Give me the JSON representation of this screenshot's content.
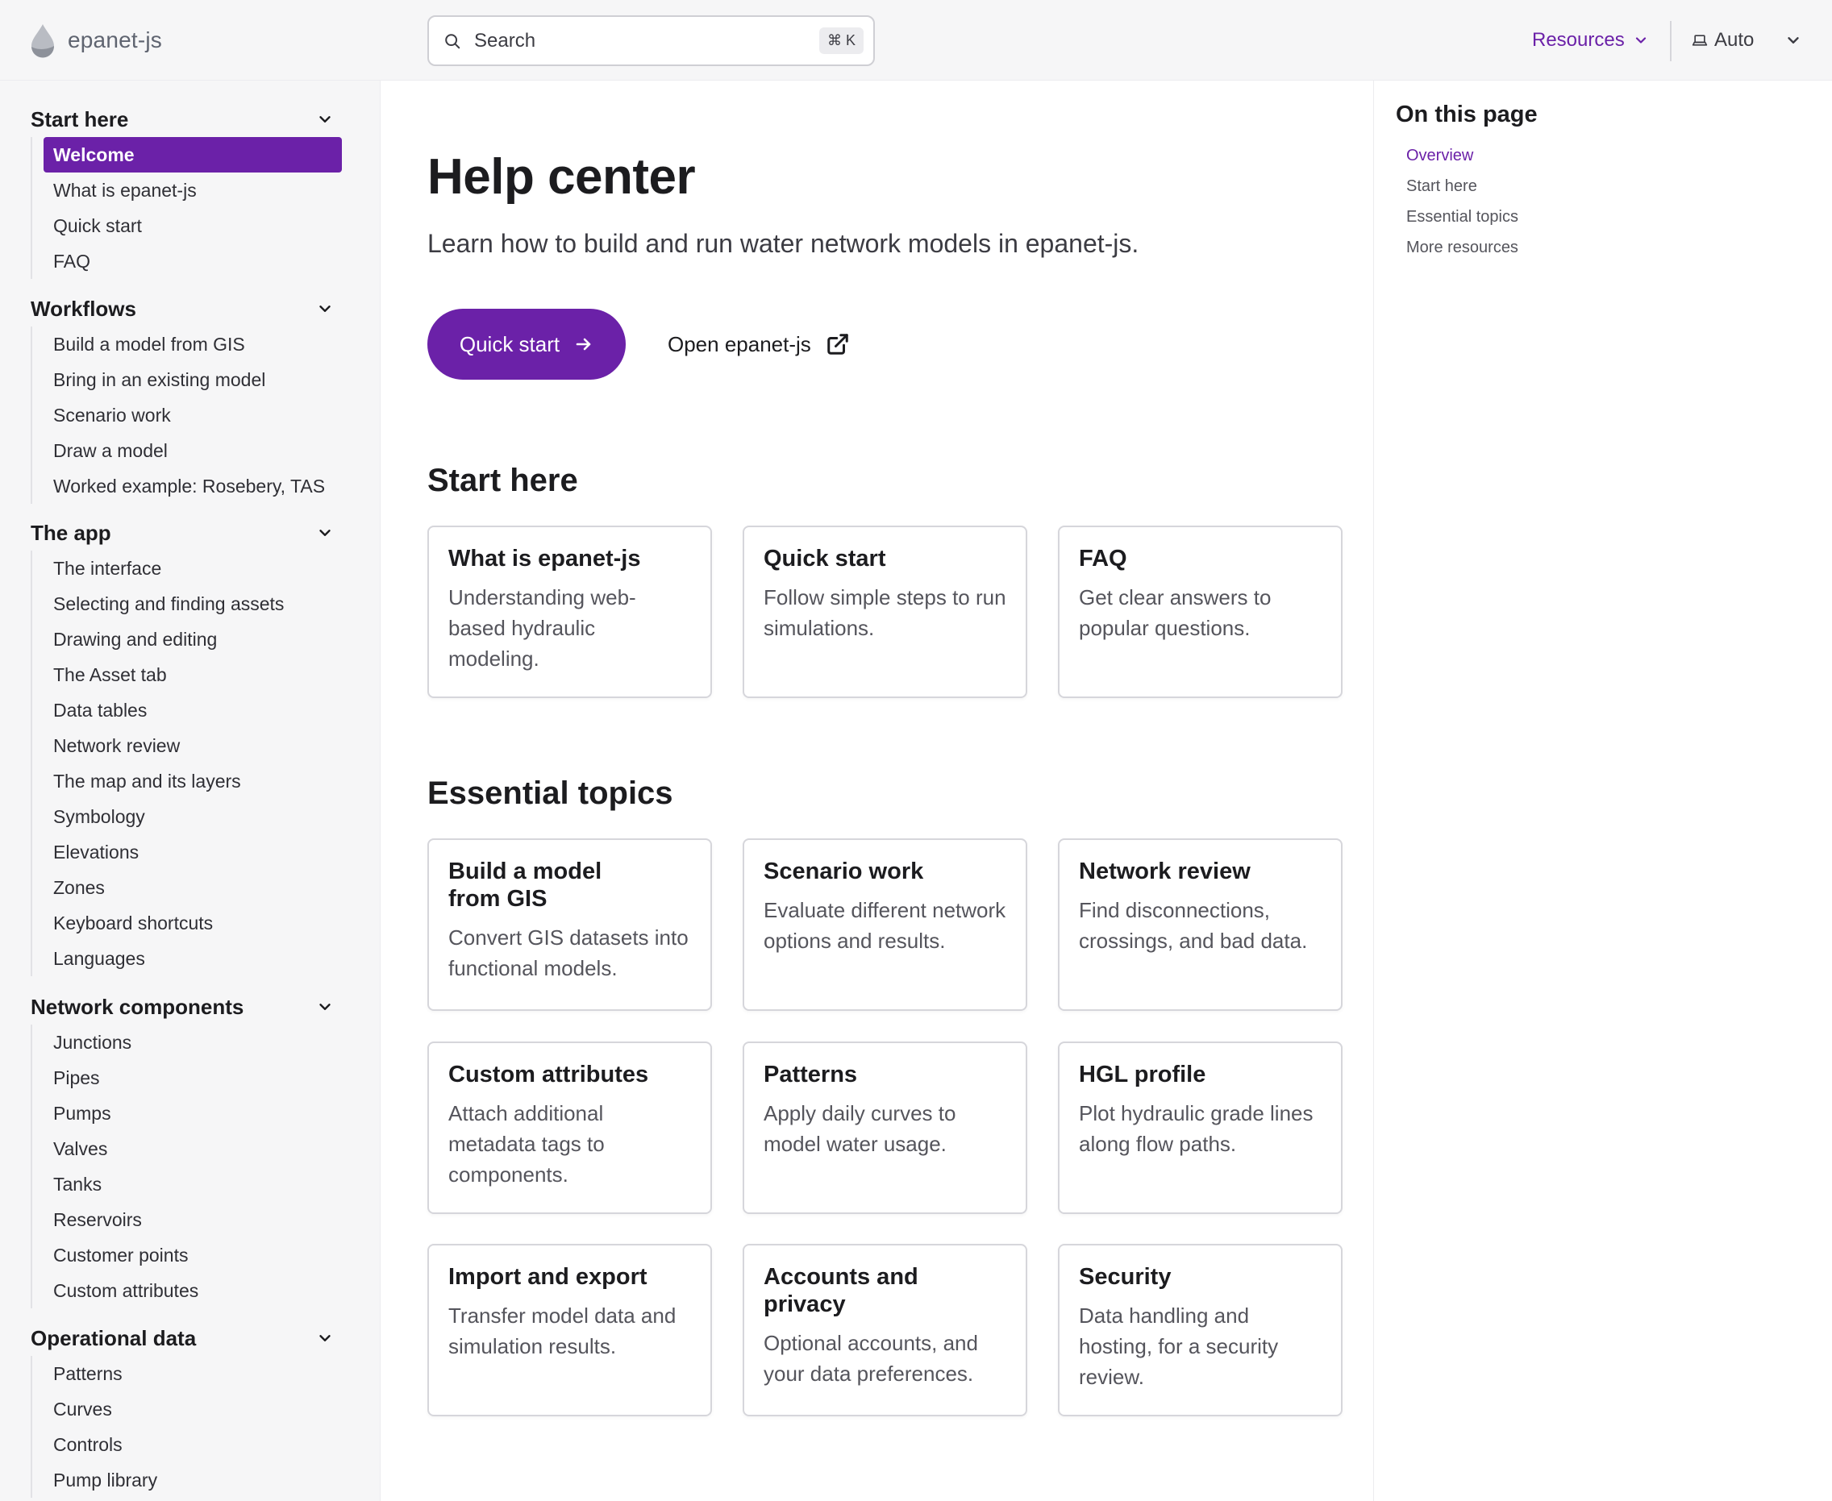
{
  "header": {
    "logo_text": "epanet-js",
    "search_placeholder": "Search",
    "search_shortcut": "⌘ K",
    "resources_label": "Resources",
    "theme_label": "Auto"
  },
  "sidebar": {
    "groups": [
      {
        "title": "Start here",
        "items": [
          "Welcome",
          "What is epanet-js",
          "Quick start",
          "FAQ"
        ],
        "active_item": "Welcome"
      },
      {
        "title": "Workflows",
        "items": [
          "Build a model from GIS",
          "Bring in an existing model",
          "Scenario work",
          "Draw a model",
          "Worked example: Rosebery, TAS"
        ]
      },
      {
        "title": "The app",
        "items": [
          "The interface",
          "Selecting and finding assets",
          "Drawing and editing",
          "The Asset tab",
          "Data tables",
          "Network review",
          "The map and its layers",
          "Symbology",
          "Elevations",
          "Zones",
          "Keyboard shortcuts",
          "Languages"
        ]
      },
      {
        "title": "Network components",
        "items": [
          "Junctions",
          "Pipes",
          "Pumps",
          "Valves",
          "Tanks",
          "Reservoirs",
          "Customer points",
          "Custom attributes"
        ]
      },
      {
        "title": "Operational data",
        "items": [
          "Patterns",
          "Curves",
          "Controls",
          "Pump library"
        ]
      }
    ]
  },
  "main": {
    "title": "Help center",
    "lead": "Learn how to build and run water network models in epanet-js.",
    "primary_button": "Quick start",
    "secondary_link": "Open epanet-js",
    "sections": [
      {
        "title": "Start here",
        "cards": [
          {
            "title": "What is epanet-js",
            "desc": "Understanding web-based hydraulic modeling."
          },
          {
            "title": "Quick start",
            "desc": "Follow simple steps to run simulations."
          },
          {
            "title": "FAQ",
            "desc": "Get clear answers to popular questions."
          }
        ]
      },
      {
        "title": "Essential topics",
        "cards": [
          {
            "title": "Build a model from GIS",
            "desc": "Convert GIS datasets into functional models."
          },
          {
            "title": "Scenario work",
            "desc": "Evaluate different network options and results."
          },
          {
            "title": "Network review",
            "desc": "Find disconnections, crossings, and bad data."
          },
          {
            "title": "Custom attributes",
            "desc": "Attach additional metadata tags to components."
          },
          {
            "title": "Patterns",
            "desc": "Apply daily curves to model water usage."
          },
          {
            "title": "HGL profile",
            "desc": "Plot hydraulic grade lines along flow paths."
          },
          {
            "title": "Import and export",
            "desc": "Transfer model data and simulation results."
          },
          {
            "title": "Accounts and privacy",
            "desc": "Optional accounts, and your data preferences."
          },
          {
            "title": "Security",
            "desc": "Data handling and hosting, for a security review."
          }
        ]
      }
    ]
  },
  "toc": {
    "title": "On this page",
    "items": [
      "Overview",
      "Start here",
      "Essential topics",
      "More resources"
    ],
    "active_item": "Overview"
  },
  "colors": {
    "accent": "#6b21a8",
    "sidebar_bg": "#f6f6f7",
    "border": "#d6d6db"
  }
}
